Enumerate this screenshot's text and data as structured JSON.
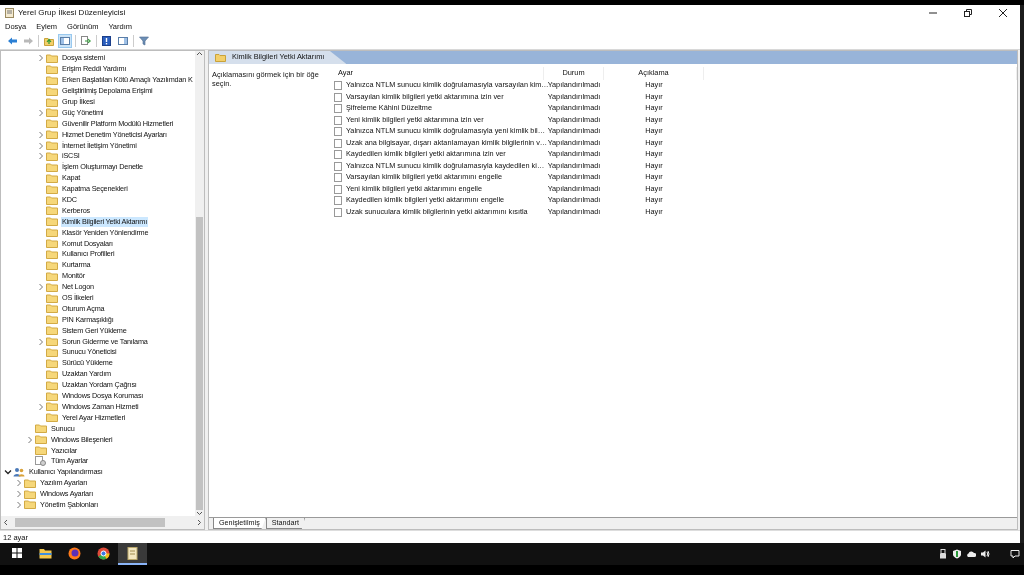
{
  "window": {
    "title": "Yerel Grup İlkesi Düzenleyicisi"
  },
  "menu": [
    "Dosya",
    "Eylem",
    "Görünüm",
    "Yardım"
  ],
  "toolbar_groups": [
    {
      "buttons": [
        {
          "kind": "back",
          "disabled": false,
          "pressed": false
        },
        {
          "kind": "forward",
          "disabled": true,
          "pressed": false
        }
      ]
    },
    {
      "buttons": [
        {
          "kind": "up",
          "disabled": false,
          "pressed": false
        },
        {
          "kind": "tree",
          "disabled": false,
          "pressed": true
        }
      ]
    },
    {
      "buttons": [
        {
          "kind": "export",
          "disabled": false,
          "pressed": false
        }
      ]
    },
    {
      "buttons": [
        {
          "kind": "help",
          "disabled": false,
          "pressed": false
        },
        {
          "kind": "pane",
          "disabled": false,
          "pressed": false
        }
      ]
    },
    {
      "buttons": [
        {
          "kind": "filter",
          "disabled": false,
          "pressed": false
        }
      ]
    }
  ],
  "tree": {
    "items": [
      {
        "children": [
          {
            "children": [
              {
                "children": [
                  {
                    "label": "Dosya sistemi",
                    "kind": "folder",
                    "expandable": true,
                    "expanded": false,
                    "selected": false
                  },
                  {
                    "label": "Erişim Reddi Yardımı",
                    "kind": "folder",
                    "expandable": false,
                    "selected": false
                  },
                  {
                    "label": "Erken Başlatılan Kötü Amaçlı Yazılımdan K",
                    "kind": "folder",
                    "expandable": false,
                    "selected": false
                  },
                  {
                    "label": "Geliştirilmiş Depolama Erişimi",
                    "kind": "folder",
                    "expandable": false,
                    "selected": false
                  },
                  {
                    "label": "Grup İlkesi",
                    "kind": "folder",
                    "expandable": false,
                    "selected": false
                  },
                  {
                    "label": "Güç Yönetimi",
                    "kind": "folder",
                    "expandable": true,
                    "expanded": false,
                    "selected": false
                  },
                  {
                    "label": "Güvenilir Platform Modülü Hizmetleri",
                    "kind": "folder",
                    "expandable": false,
                    "selected": false
                  },
                  {
                    "label": "Hizmet Denetim Yöneticisi Ayarları",
                    "kind": "folder",
                    "expandable": true,
                    "expanded": false,
                    "selected": false
                  },
                  {
                    "label": "İnternet İletişim Yönetimi",
                    "kind": "folder",
                    "expandable": true,
                    "expanded": false,
                    "selected": false
                  },
                  {
                    "label": "iSCSI",
                    "kind": "folder",
                    "expandable": true,
                    "expanded": false,
                    "selected": false
                  },
                  {
                    "label": "İşlem Oluşturmayı Denetle",
                    "kind": "folder",
                    "expandable": false,
                    "selected": false
                  },
                  {
                    "label": "Kapat",
                    "kind": "folder",
                    "expandable": false,
                    "selected": false
                  },
                  {
                    "label": "Kapatma Seçenekleri",
                    "kind": "folder",
                    "expandable": false,
                    "selected": false
                  },
                  {
                    "label": "KDC",
                    "kind": "folder",
                    "expandable": false,
                    "selected": false
                  },
                  {
                    "label": "Kerberos",
                    "kind": "folder",
                    "expandable": false,
                    "selected": false
                  },
                  {
                    "label": "Kimlik Bilgileri Yetki Aktarımı",
                    "kind": "folder",
                    "expandable": false,
                    "selected": true
                  },
                  {
                    "label": "Klasör Yeniden Yönlendirme",
                    "kind": "folder",
                    "expandable": false,
                    "selected": false
                  },
                  {
                    "label": "Komut Dosyaları",
                    "kind": "folder",
                    "expandable": false,
                    "selected": false
                  },
                  {
                    "label": "Kullanıcı Profilleri",
                    "kind": "folder",
                    "expandable": false,
                    "selected": false
                  },
                  {
                    "label": "Kurtarma",
                    "kind": "folder",
                    "expandable": false,
                    "selected": false
                  },
                  {
                    "label": "Monitör",
                    "kind": "folder",
                    "expandable": false,
                    "selected": false
                  },
                  {
                    "label": "Net Logon",
                    "kind": "folder",
                    "expandable": true,
                    "expanded": false,
                    "selected": false
                  },
                  {
                    "label": "OS İlkeleri",
                    "kind": "folder",
                    "expandable": false,
                    "selected": false
                  },
                  {
                    "label": "Oturum Açma",
                    "kind": "folder",
                    "expandable": false,
                    "selected": false
                  },
                  {
                    "label": "PIN Karmaşıklığı",
                    "kind": "folder",
                    "expandable": false,
                    "selected": false
                  },
                  {
                    "label": "Sistem Geri Yükleme",
                    "kind": "folder",
                    "expandable": false,
                    "selected": false
                  },
                  {
                    "label": "Sorun Giderme ve Tanılama",
                    "kind": "folder",
                    "expandable": true,
                    "expanded": false,
                    "selected": false
                  },
                  {
                    "label": "Sunucu Yöneticisi",
                    "kind": "folder",
                    "expandable": false,
                    "selected": false
                  },
                  {
                    "label": "Sürücü Yükleme",
                    "kind": "folder",
                    "expandable": false,
                    "selected": false
                  },
                  {
                    "label": "Uzaktan Yardım",
                    "kind": "folder",
                    "expandable": false,
                    "selected": false
                  },
                  {
                    "label": "Uzaktan Yordam Çağrısı",
                    "kind": "folder",
                    "expandable": false,
                    "selected": false
                  },
                  {
                    "label": "Windows Dosya Koruması",
                    "kind": "folder",
                    "expandable": false,
                    "selected": false
                  },
                  {
                    "label": "Windows Zaman Hizmeti",
                    "kind": "folder",
                    "expandable": true,
                    "expanded": false,
                    "selected": false
                  },
                  {
                    "label": "Yerel Ayar Hizmetleri",
                    "kind": "folder",
                    "expandable": false,
                    "selected": false
                  }
                ]
              },
              {
                "label": "Sunucu",
                "kind": "folder",
                "expandable": false,
                "selected": false
              },
              {
                "label": "Windows Bileşenleri",
                "kind": "folder",
                "expandable": true,
                "expanded": false,
                "selected": false
              },
              {
                "label": "Yazıcılar",
                "kind": "folder",
                "expandable": false,
                "selected": false
              },
              {
                "label": "Tüm Ayarlar",
                "kind": "settings",
                "expandable": false,
                "selected": false
              }
            ]
          }
        ]
      },
      {
        "label": "Kullanıcı Yapılandırması",
        "kind": "users",
        "expandable": true,
        "expanded": true,
        "selected": false,
        "children": [
          {
            "label": "Yazılım Ayarları",
            "kind": "folder",
            "expandable": true,
            "expanded": false,
            "selected": false
          },
          {
            "label": "Windows Ayarları",
            "kind": "folder",
            "expandable": true,
            "expanded": false,
            "selected": false
          },
          {
            "label": "Yönetim Şablonları",
            "kind": "folder",
            "expandable": true,
            "expanded": false,
            "selected": false
          }
        ]
      }
    ]
  },
  "details": {
    "header": "Kimlik Bilgileri Yetki Aktarımı",
    "description": "Açıklamasını görmek için bir öğe seçin.",
    "columns": [
      "Ayar",
      "Durum",
      "Açıklama"
    ],
    "rows": [
      {
        "setting": "Yalnızca NTLM sunucu kimlik doğrulamasıyla varsayılan kim…",
        "state": "Yapılandırılmadı",
        "comment": "Hayır"
      },
      {
        "setting": "Varsayılan kimlik bilgileri yetki aktarımına izin ver",
        "state": "Yapılandırılmadı",
        "comment": "Hayır"
      },
      {
        "setting": "Şifreleme Kâhini Düzeltme",
        "state": "Yapılandırılmadı",
        "comment": "Hayır"
      },
      {
        "setting": "Yeni kimlik bilgileri yetki aktarımına izin ver",
        "state": "Yapılandırılmadı",
        "comment": "Hayır"
      },
      {
        "setting": "Yalnızca NTLM sunucu kimlik doğrulamasıyla yeni kimlik bil…",
        "state": "Yapılandırılmadı",
        "comment": "Hayır"
      },
      {
        "setting": "Uzak ana bilgisayar, dışarı aktarılamayan kimlik bilgilerinin v…",
        "state": "Yapılandırılmadı",
        "comment": "Hayır"
      },
      {
        "setting": "Kaydedilen kimlik bilgileri yetki aktarımına izin ver",
        "state": "Yapılandırılmadı",
        "comment": "Hayır"
      },
      {
        "setting": "Yalnızca NTLM sunucu kimlik doğrulamasıyla kaydedilen ki…",
        "state": "Yapılandırılmadı",
        "comment": "Hayır"
      },
      {
        "setting": "Varsayılan kimlik bilgileri yetki aktarımını engelle",
        "state": "Yapılandırılmadı",
        "comment": "Hayır"
      },
      {
        "setting": "Yeni kimlik bilgileri yetki aktarımını engelle",
        "state": "Yapılandırılmadı",
        "comment": "Hayır"
      },
      {
        "setting": "Kaydedilen kimlik bilgileri yetki aktarımını engelle",
        "state": "Yapılandırılmadı",
        "comment": "Hayır"
      },
      {
        "setting": "Uzak sunuculara kimlik bilgilerinin yetki aktarımını kısıtla",
        "state": "Yapılandırılmadı",
        "comment": "Hayır"
      }
    ],
    "tabs": [
      {
        "label": "Genişletilmiş",
        "selected": true
      },
      {
        "label": "Standart",
        "selected": false
      }
    ]
  },
  "status_bar": "12 ayar",
  "taskbar": {
    "apps": [
      {
        "kind": "explorer",
        "active": false
      },
      {
        "kind": "firefox",
        "active": false
      },
      {
        "kind": "chrome",
        "active": false
      },
      {
        "kind": "notepad",
        "active": true
      }
    ],
    "tray": [
      {
        "kind": "usb"
      },
      {
        "kind": "shield"
      },
      {
        "kind": "cloud"
      },
      {
        "kind": "speaker"
      },
      {
        "kind": "notifications"
      }
    ]
  }
}
